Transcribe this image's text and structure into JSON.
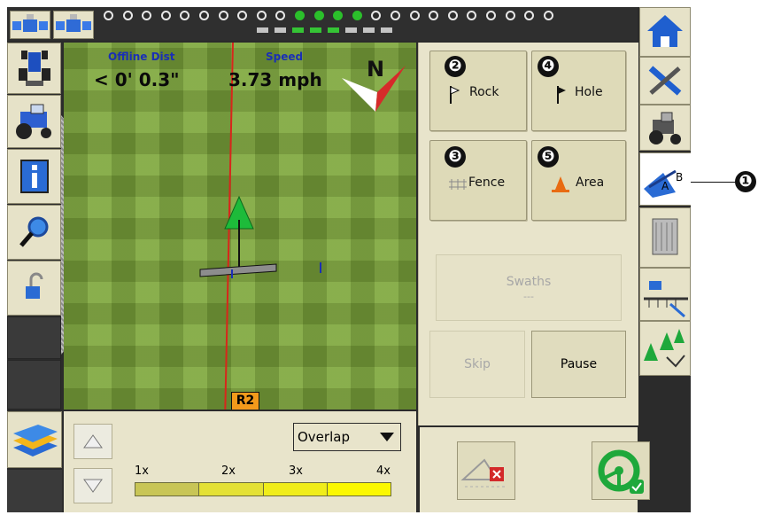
{
  "hud": {
    "offline_label": "Offline Dist",
    "offline_value": "< 0' 0.3\"",
    "speed_label": "Speed",
    "speed_value": "3.73 mph",
    "north": "N",
    "row_tag": "R2"
  },
  "gps_indicators": {
    "leds": [
      false,
      false,
      false,
      false,
      false,
      false,
      false,
      false,
      false,
      false,
      true,
      true,
      true,
      true,
      false,
      false,
      false,
      false,
      false,
      false,
      false,
      false,
      false,
      false
    ],
    "segments": [
      false,
      false,
      true,
      true,
      true,
      false,
      false,
      false
    ]
  },
  "marks": [
    {
      "number": "❷",
      "label": "Rock"
    },
    {
      "number": "❹",
      "label": "Hole"
    },
    {
      "number": "❸",
      "label": "Fence"
    },
    {
      "number": "❺",
      "label": "Area"
    }
  ],
  "swaths": {
    "title": "Swaths",
    "value": "---"
  },
  "buttons": {
    "skip": "Skip",
    "pause": "Pause"
  },
  "overlap": {
    "selected": "Overlap",
    "scale": [
      "1x",
      "2x",
      "3x",
      "4x"
    ],
    "scale_colors": [
      "#c8c556",
      "#e4e136",
      "#f0ed1a",
      "#fbf800"
    ]
  },
  "callout": {
    "number": "❶"
  },
  "tabs": {
    "ab_a": "A",
    "ab_b": "B"
  },
  "colors": {
    "accent_green": "#2bbf2b",
    "panel": "#e8e4cb",
    "guidance_red": "#d8261b",
    "row_tag": "#f39a1b"
  }
}
